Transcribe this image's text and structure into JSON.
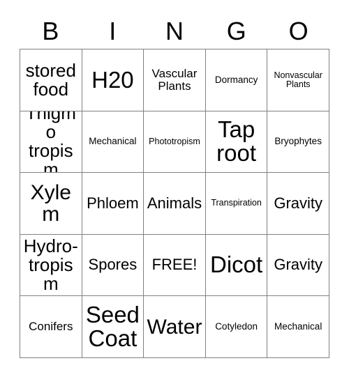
{
  "card": {
    "title_letters": [
      "B",
      "I",
      "N",
      "G",
      "O"
    ],
    "free_space_label": "FREE!",
    "colors": {
      "background": "#ffffff",
      "text": "#000000",
      "grid_line": "#808080"
    },
    "rows": [
      [
        {
          "label": "stored\nfood",
          "size": "lg"
        },
        {
          "label": "H20",
          "size": "xxl"
        },
        {
          "label": "Vascular\nPlants",
          "size": "sm"
        },
        {
          "label": "Dormancy",
          "size": "xs"
        },
        {
          "label": "Nonvascular\nPlants",
          "size": "xxs"
        }
      ],
      [
        {
          "label": "Thigmo\ntropism",
          "size": "lg"
        },
        {
          "label": "Mechanical",
          "size": "xs"
        },
        {
          "label": "Phototropism",
          "size": "xxs"
        },
        {
          "label": "Tap\nroot",
          "size": "xxl"
        },
        {
          "label": "Bryophytes",
          "size": "xs"
        }
      ],
      [
        {
          "label": "Xylem",
          "size": "xl"
        },
        {
          "label": "Phloem",
          "size": "md"
        },
        {
          "label": "Animals",
          "size": "md"
        },
        {
          "label": "Transpiration",
          "size": "xxs"
        },
        {
          "label": "Gravity",
          "size": "md"
        }
      ],
      [
        {
          "label": "Hydro-\ntropism",
          "size": "lg"
        },
        {
          "label": "Spores",
          "size": "md"
        },
        {
          "label": "FREE!",
          "size": "md"
        },
        {
          "label": "Dicot",
          "size": "xxl"
        },
        {
          "label": "Gravity",
          "size": "md"
        }
      ],
      [
        {
          "label": "Conifers",
          "size": "sm"
        },
        {
          "label": "Seed\nCoat",
          "size": "xxl"
        },
        {
          "label": "Water",
          "size": "xl"
        },
        {
          "label": "Cotyledon",
          "size": "xs"
        },
        {
          "label": "Mechanical",
          "size": "xs"
        }
      ]
    ]
  }
}
